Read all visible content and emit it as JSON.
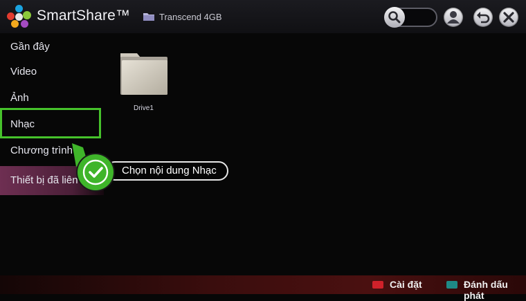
{
  "header": {
    "app_title": "SmartShare™",
    "device_label": "Transcend 4GB",
    "search_placeholder": ""
  },
  "sidebar": {
    "items": [
      {
        "label": "Gần đây"
      },
      {
        "label": "Video"
      },
      {
        "label": "Ảnh"
      },
      {
        "label": "Nhạc"
      },
      {
        "label": "Chương trình"
      },
      {
        "label": "Thiết bị đã liên kết"
      }
    ]
  },
  "content": {
    "folders": [
      {
        "label": "Drive1",
        "icon": "folder-icon"
      }
    ]
  },
  "annotation": {
    "callout_text": "Chọn nội dung Nhạc",
    "highlight_color": "#46c22b"
  },
  "footer": {
    "settings_label": "Cài đặt",
    "settings_key_color": "#d0212a",
    "bookmark_label": "Đánh dấu phát",
    "bookmark_key_color": "#1e8a86"
  },
  "icons": {
    "search": "search-icon",
    "user": "user-icon",
    "back": "back-icon",
    "close": "close-icon"
  }
}
